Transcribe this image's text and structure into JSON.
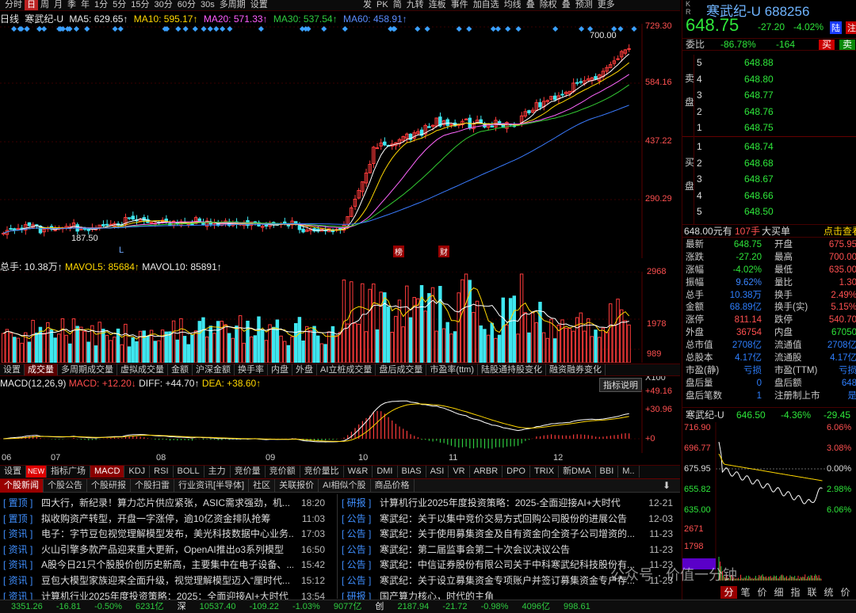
{
  "topbar": {
    "left_items": [
      "分时",
      "日",
      "周",
      "月",
      "季",
      "年",
      "1分",
      "5分",
      "15分",
      "30分",
      "60分",
      "30s",
      "多周期",
      "设置"
    ],
    "active": "日",
    "right_items": [
      "发",
      "PK",
      "简",
      "九转",
      "连板",
      "事件",
      "加自选",
      "均线",
      "叠",
      "除权",
      "叠",
      "预测",
      "更多"
    ]
  },
  "ma_legend": {
    "name": "寒武纪-U",
    "ma5": "MA5: 629.65↑",
    "ma10": "MA10: 595.17↑",
    "ma20": "MA20: 571.33↑",
    "ma30": "MA30: 537.54↑",
    "ma60": "MA60: 458.91↑",
    "left_label": "日线"
  },
  "price_axis": [
    "729.30",
    "584.16",
    "437.22",
    "290.29"
  ],
  "price_marks": {
    "high": "700.00",
    "low": "187.50",
    "badge1": "榜",
    "badge2": "财",
    "l_mark": "L"
  },
  "volume": {
    "legend_total": "总手: 10.38万↑",
    "legend_mavol5": "MAVOL5: 85684↑",
    "legend_mavol10": "MAVOL10: 85891↑",
    "axis": [
      "2968",
      "1978",
      "989",
      "X100"
    ]
  },
  "indicator_tabs": [
    "设置",
    "成交量",
    "多周期成交量",
    "虚拟成交量",
    "金额",
    "沪深金额",
    "换手率",
    "内盘",
    "外盘",
    "AI立桩成交量",
    "盘后成交量",
    "市盈率(ttm)",
    "陆股通持股变化",
    "融资融券变化"
  ],
  "indicator_tabs_active": "成交量",
  "macd": {
    "legend_name": "MACD(12,26,9)",
    "legend_macd": "MACD: +12.20↓",
    "legend_diff": "DIFF: +44.70↑",
    "legend_dea": "DEA: +38.60↑",
    "help": "指标说明",
    "axis": [
      "+49.16",
      "+30.96",
      "+0"
    ]
  },
  "months": [
    "06",
    "07",
    "08",
    "09",
    "10",
    "11",
    "12"
  ],
  "tabs2": [
    "设置",
    "NEW",
    "指标广场",
    "MACD",
    "KDJ",
    "RSI",
    "BOLL",
    "主力",
    "竞价量",
    "竞价额",
    "竞价量比",
    "W&R",
    "DMI",
    "BIAS",
    "ASI",
    "VR",
    "ARBR",
    "DPO",
    "TRIX",
    "新DMA",
    "BBI",
    "M.."
  ],
  "tabs2_active": "MACD",
  "news_tabs": [
    "个股新闻",
    "个股公告",
    "个股研报",
    "个股扫雷",
    "行业资讯[半导体]",
    "社区",
    "关联报价",
    "AI相似个股",
    "商品价格"
  ],
  "news_tabs_active": "个股新闻",
  "news_left": [
    {
      "tag": "置顶",
      "title": "四大行，新纪录！算力芯片供应紧张，ASIC需求强劲，机...",
      "time": "18:20"
    },
    {
      "tag": "置顶",
      "title": "拟收购资产转型，开盘一字涨停，逾10亿资金排队抢筹",
      "time": "11:03"
    },
    {
      "tag": "资讯",
      "title": "电子：字节豆包视觉理解模型发布，美光科技数据中心业务...",
      "time": "17:03"
    },
    {
      "tag": "资讯",
      "title": "火山引擎多款产品迎来重大更新，OpenAI推出o3系列模型",
      "time": "16:50"
    },
    {
      "tag": "资讯",
      "title": "A股今日21只个股股价创历史新高，主要集中在电子设备、...",
      "time": "15:42"
    },
    {
      "tag": "资讯",
      "title": "豆包大模型家族迎来全面升级，视觉理解模型迈入“厘时代...",
      "time": "15:12"
    },
    {
      "tag": "资讯",
      "title": "计算机行业2025年度投资策略：2025：全面迎接AI+大时代",
      "time": "13:54"
    }
  ],
  "news_right": [
    {
      "tag": "研报",
      "title": "计算机行业2025年度投资策略：2025-全面迎接AI+大时代",
      "time": "12-21"
    },
    {
      "tag": "公告",
      "title": "寒武纪：关于以集中竞价交易方式回购公司股份的进展公告",
      "time": "12-03"
    },
    {
      "tag": "公告",
      "title": "寒武纪：关于使用募集资金及自有资金向全资子公司增资的...",
      "time": "11-23"
    },
    {
      "tag": "公告",
      "title": "寒武纪：第二届监事会第二十次会议决议公告",
      "time": "11-23"
    },
    {
      "tag": "公告",
      "title": "寒武纪：中信证券股份有限公司关于中科寒武纪科技股份有...",
      "time": "11-23"
    },
    {
      "tag": "公告",
      "title": "寒武纪：关于设立募集资金专项账户并签订募集资金专户存...",
      "time": "11-23"
    },
    {
      "tag": "研报",
      "title": "国产算力核心，时代的主角",
      "time": ""
    }
  ],
  "statusbar": {
    "sh_index": "3351.26",
    "sh_change": "-16.81",
    "sh_pct": "-0.50%",
    "sh_amount": "6231亿",
    "sz_label": "深",
    "sz_index": "10537.40",
    "sz_change": "-109.22",
    "sz_pct": "-1.03%",
    "sz_amount": "9077亿",
    "cy_label": "创",
    "cy_index": "2187.94",
    "cy_change": "-21.72",
    "cy_pct": "-0.98%",
    "cy_amount": "4096亿",
    "last": "998.61"
  },
  "right": {
    "kr": "K R",
    "stock_name": "寒武纪-U",
    "stock_code": "688256",
    "price": "648.75",
    "change": "-27.20",
    "pct": "-4.02%",
    "tag": "陆",
    "tag2": "注",
    "weibi_label": "委比",
    "weibi_value": "-86.78%",
    "weicha_value": "-164",
    "buy_btn": "买",
    "sell_btn": "卖",
    "sell_label": "卖盘",
    "buy_label": "买盘",
    "asks": [
      {
        "lvl": "5",
        "price": "648.88"
      },
      {
        "lvl": "4",
        "price": "648.80"
      },
      {
        "lvl": "3",
        "price": "648.77"
      },
      {
        "lvl": "2",
        "price": "648.76"
      },
      {
        "lvl": "1",
        "price": "648.75"
      }
    ],
    "bids": [
      {
        "lvl": "1",
        "price": "648.74"
      },
      {
        "lvl": "2",
        "price": "648.68"
      },
      {
        "lvl": "3",
        "price": "648.67"
      },
      {
        "lvl": "4",
        "price": "648.66"
      },
      {
        "lvl": "5",
        "price": "648.50"
      }
    ],
    "bigbuy": {
      "price": "648.00元有",
      "count": "107手",
      "label": "大买单",
      "link": "点击查看"
    },
    "stats": [
      [
        "最新",
        "648.75",
        "开盘",
        "675.95"
      ],
      [
        "涨跌",
        "-27.20",
        "最高",
        "700.00"
      ],
      [
        "涨幅",
        "-4.02%",
        "最低",
        "635.00"
      ],
      [
        "振幅",
        "9.62%",
        "量比",
        "1.30"
      ],
      [
        "总手",
        "10.38万",
        "换手",
        "2.49%"
      ],
      [
        "金额",
        "68.89亿",
        "换手(实)",
        "5.15%"
      ],
      [
        "涨停",
        "811.14",
        "跌停",
        "540.70"
      ],
      [
        "外盘",
        "36754",
        "内盘",
        "67050"
      ],
      [
        "总市值",
        "2708亿",
        "流通值",
        "2708亿"
      ],
      [
        "总股本",
        "4.17亿",
        "流通股",
        "4.17亿"
      ],
      [
        "市盈(静)",
        "亏损",
        "市盈(TTM)",
        "亏损"
      ],
      [
        "盘后量",
        "0",
        "盘后额",
        "648"
      ],
      [
        "盘后笔数",
        "1",
        "注册制上市",
        "是"
      ]
    ],
    "mini": {
      "name": "寒武纪-U",
      "price": "646.50",
      "pct": "-4.36%",
      "change": "-29.45",
      "left_axis": [
        "716.90",
        "696.77",
        "675.95",
        "655.82",
        "635.00",
        "2671",
        "1798",
        "908"
      ],
      "right_axis": [
        "6.06%",
        "3.08%",
        "0.00%",
        "2.98%",
        "6.06%"
      ]
    },
    "bottom_tabs": [
      "分",
      "笔",
      "价",
      "细",
      "指",
      "联",
      "统",
      "价"
    ]
  },
  "watermark": "公众号 · 价值一分钟",
  "colors": {
    "up": "#ff3b3b",
    "down": "#3fe7f0",
    "ma5": "#ffffff",
    "ma10": "#ffd700",
    "ma20": "#ff66ff",
    "ma30": "#33cc33",
    "ma60": "#3a7bff"
  }
}
